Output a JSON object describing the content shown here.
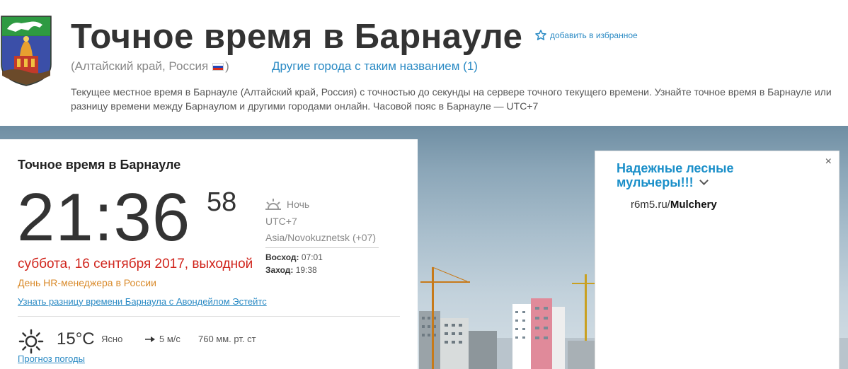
{
  "header": {
    "title": "Точное время в Барнауле",
    "favorite_label": "добавить в избранное",
    "region": "(Алтайский край, Россия",
    "region_close": ")",
    "other_cities_link": "Другие города с таким названием (1)",
    "description": "Текущее местное время в Барнауле (Алтайский край, Россия) с точностью до секунды на сервере точного текущего времени. Узнайте точное время в Барнауле или разницу времени между Барнаулом и другими городами онлайн. Часовой пояс в Барнауле — UTC+7"
  },
  "clock": {
    "card_title": "Точное время в Барнауле",
    "time": "21:36",
    "seconds": "58",
    "day_phase": "Ночь",
    "utc": "UTC+7",
    "timezone": "Asia/Novokuznetsk (+07)",
    "sunrise_label": "Восход:",
    "sunrise": "07:01",
    "sunset_label": "Заход:",
    "sunset": "19:38",
    "date": "суббота, 16 сентября 2017, выходной",
    "holiday": "День HR-менеджера в России",
    "diff_link": "Узнать разницу времени Барнаула с Авондейлом Эстейтс"
  },
  "weather": {
    "temperature": "15°C",
    "condition": "Ясно",
    "wind": "5 м/с",
    "pressure": "760 мм. рт. ст",
    "forecast_link": "Прогноз погоды"
  },
  "ad": {
    "close": "×",
    "title": "Надежные лесные мульчеры!!!",
    "domain_prefix": "r6m5.ru/",
    "domain_path": "Mulchery"
  },
  "colors": {
    "link": "#2a8ac4",
    "date_red": "#d0241c",
    "holiday_orange": "#d98a2a",
    "ad_title": "#1a8fc9"
  }
}
